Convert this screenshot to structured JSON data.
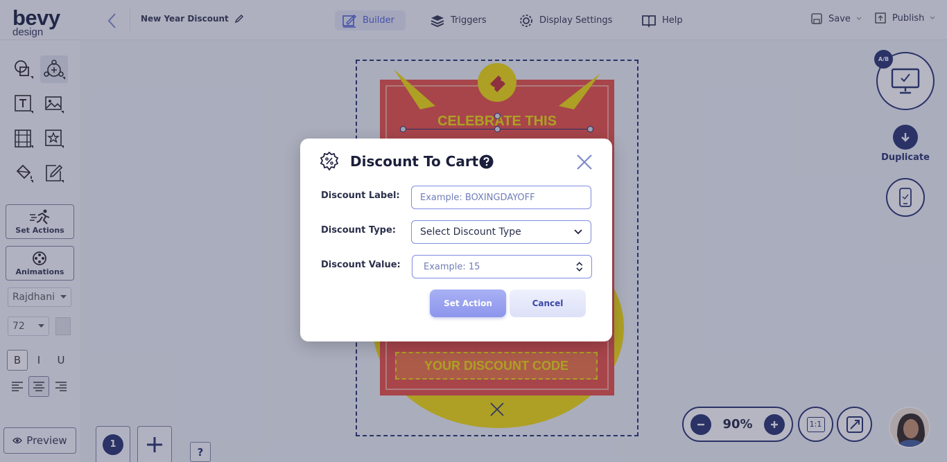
{
  "app": {
    "logo_top": "bevy",
    "logo_bottom": "design"
  },
  "header": {
    "campaign_title": "New Year Discount",
    "nav": [
      {
        "label": "Builder",
        "active": true,
        "icon": "builder-icon"
      },
      {
        "label": "Triggers",
        "active": false,
        "icon": "layers-icon"
      },
      {
        "label": "Display Settings",
        "active": false,
        "icon": "gear-icon"
      },
      {
        "label": "Help",
        "active": false,
        "icon": "book-icon"
      }
    ],
    "save_label": "Save",
    "publish_label": "Publish"
  },
  "sidebar": {
    "set_actions_label": "Set Actions",
    "animations_label": "Animations",
    "font_family": "Rajdhani",
    "font_size": "72",
    "bold_label": "B",
    "italic_label": "I",
    "underline_label": "U",
    "preview_label": "Preview"
  },
  "canvas": {
    "headline": "CELEBRATE THIS",
    "discount_code_text": "YOUR DISCOUNT CODE",
    "colors": {
      "red": "#e8493f",
      "yellow": "#f3dc00",
      "dark_red": "#c1272d"
    }
  },
  "modal": {
    "title": "Discount To Cart",
    "fields": {
      "label": {
        "label": "Discount Label:",
        "placeholder": "Example: BOXINGDAYOFF"
      },
      "type": {
        "label": "Discount Type:",
        "value": "Select Discount Type"
      },
      "value": {
        "label": "Discount Value:",
        "placeholder": "Example: 15"
      }
    },
    "set_action_label": "Set Action",
    "cancel_label": "Cancel"
  },
  "right_panel": {
    "ab_badge": "A/B",
    "duplicate_label": "Duplicate"
  },
  "zoom": {
    "value": "90%",
    "ratio_label": "1:1"
  },
  "pages": {
    "current": "1",
    "help": "?"
  },
  "theme": {
    "primary": "#1f2a6b",
    "accent": "#4a5bd6"
  }
}
